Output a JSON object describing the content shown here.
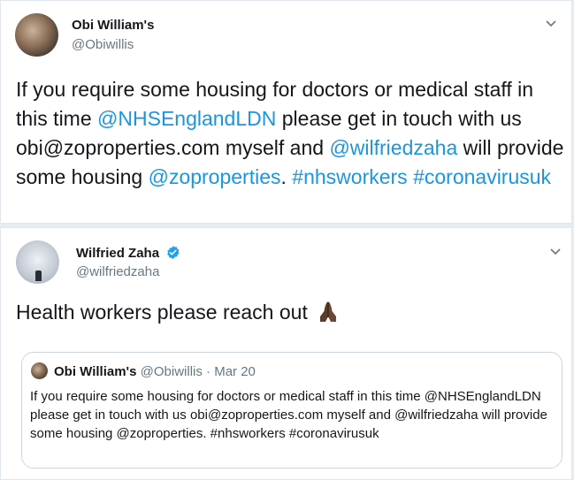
{
  "tweet1": {
    "name": "Obi William's",
    "handle": "@Obiwillis",
    "body": [
      {
        "text": "If you require some housing for doctors or medical staff in this time ",
        "type": "text"
      },
      {
        "text": "@NHSEnglandLDN",
        "type": "link"
      },
      {
        "text": " please get in touch with us obi@zoproperties.com myself and ",
        "type": "text"
      },
      {
        "text": "@wilfriedzaha",
        "type": "link"
      },
      {
        "text": " will provide some housing ",
        "type": "text"
      },
      {
        "text": "@zoproperties",
        "type": "link"
      },
      {
        "text": ". ",
        "type": "text"
      },
      {
        "text": "#nhsworkers",
        "type": "link"
      },
      {
        "text": " ",
        "type": "text"
      },
      {
        "text": "#coronavirusuk",
        "type": "link"
      }
    ],
    "menu_icon": "chevron-down-icon"
  },
  "tweet2": {
    "name": "Wilfried Zaha",
    "handle": "@wilfriedzaha",
    "verified_icon": "verified-badge-icon",
    "body_text": "Health workers please reach out",
    "emoji": "folded-hands-emoji",
    "menu_icon": "chevron-down-icon",
    "quoted": {
      "name": "Obi William's",
      "handle": "@Obiwillis",
      "separator": "·",
      "date": "Mar 20",
      "body": "If you require some housing for doctors or medical staff in this time @NHSEnglandLDN please get in touch with us obi@zoproperties.com myself and @wilfriedzaha will provide some housing @zoproperties. #nhsworkers #coronavirusuk"
    }
  },
  "colors": {
    "link": "#1b95e0",
    "verified": "#1da1f2",
    "secondary_text": "#657786",
    "border": "#e1e8ed"
  }
}
